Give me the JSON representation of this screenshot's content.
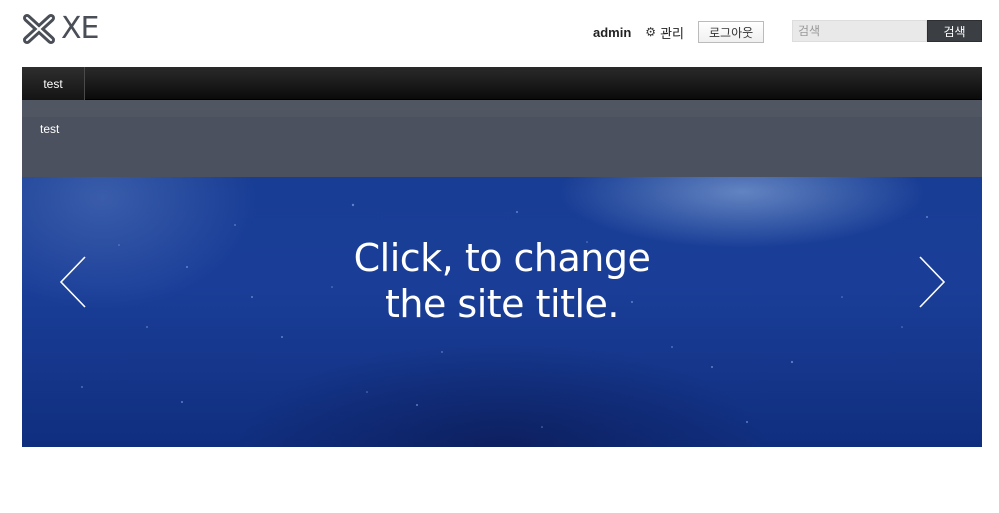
{
  "header": {
    "logo_text": "XE",
    "username": "admin",
    "manage_label": "관리",
    "logout_label": "로그아웃",
    "search_placeholder": "검색",
    "search_button": "검색"
  },
  "gnb": {
    "items": [
      {
        "label": "test"
      }
    ]
  },
  "subnav": {
    "items": [
      {
        "label": "test"
      }
    ]
  },
  "hero": {
    "title_line1": "Click, to change",
    "title_line2": "the site title.",
    "prev_icon": "chevron-left-icon",
    "next_icon": "chevron-right-icon"
  },
  "colors": {
    "gnb_bg": "#111111",
    "subnav_bg": "#4b515e",
    "hero_bg": "#1a3e98",
    "search_button_bg": "#3b3e42"
  }
}
